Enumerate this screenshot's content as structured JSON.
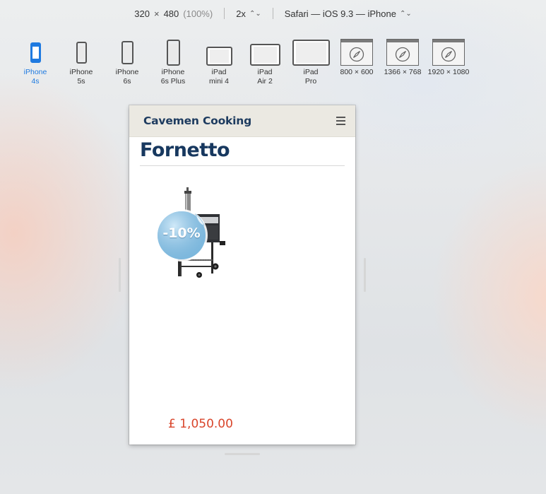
{
  "toolbar": {
    "width": "320",
    "times": "×",
    "height": "480",
    "zoom": "(100%)",
    "scale": "2x",
    "browser": "Safari — iOS 9.3 — iPhone"
  },
  "devices": [
    {
      "line1": "iPhone",
      "line2": "4s",
      "active": true
    },
    {
      "line1": "iPhone",
      "line2": "5s"
    },
    {
      "line1": "iPhone",
      "line2": "6s"
    },
    {
      "line1": "iPhone",
      "line2": "6s Plus"
    },
    {
      "line1": "iPad",
      "line2": "mini 4"
    },
    {
      "line1": "iPad",
      "line2": "Air 2"
    },
    {
      "line1": "iPad",
      "line2": "Pro"
    },
    {
      "line1": "800 × 600",
      "line2": ""
    },
    {
      "line1": "1366 × 768",
      "line2": ""
    },
    {
      "line1": "1920 × 1080",
      "line2": ""
    }
  ],
  "site": {
    "title": "Cavemen Cooking",
    "menu_icon": "hamburger-icon"
  },
  "page": {
    "title": "Fornetto",
    "discount_badge": "-10%",
    "price": "£ 1,050.00"
  },
  "colors": {
    "active_device": "#1f7ae0",
    "header_bg": "#ebe9e2",
    "title_navy": "#17385f",
    "price_red": "#d9452b",
    "badge_blue": "#7fbbe0"
  }
}
